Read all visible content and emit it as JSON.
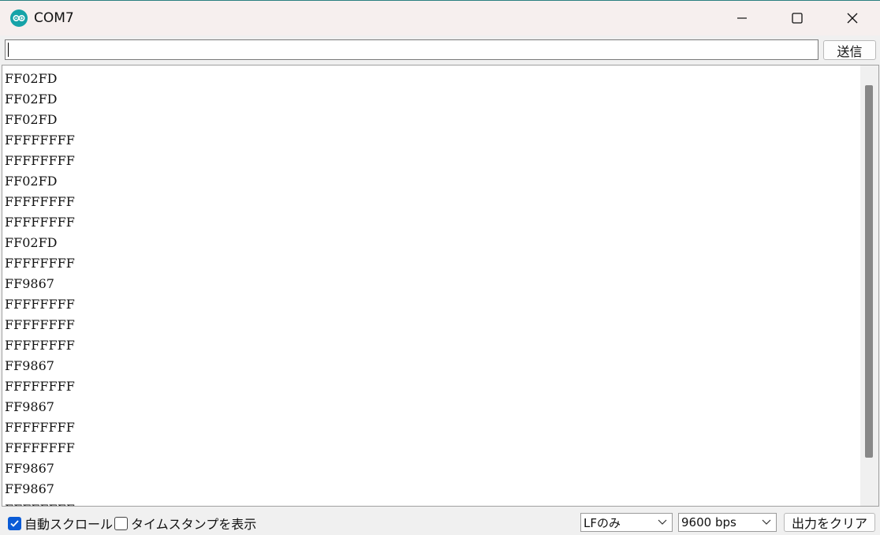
{
  "window": {
    "title": "COM7",
    "minimize_icon": "minimize-icon",
    "maximize_icon": "maximize-icon",
    "close_icon": "close-icon"
  },
  "send_bar": {
    "input_value": "",
    "send_label": "送信"
  },
  "output": {
    "lines": [
      "FF02FD",
      "FF02FD",
      "FF02FD",
      "FFFFFFFF",
      "FFFFFFFF",
      "FF02FD",
      "FFFFFFFF",
      "FFFFFFFF",
      "FF02FD",
      "FFFFFFFF",
      "FF9867",
      "FFFFFFFF",
      "FFFFFFFF",
      "FFFFFFFF",
      "FF9867",
      "FFFFFFFF",
      "FF9867",
      "FFFFFFFF",
      "FFFFFFFF",
      "FF9867",
      "FF9867",
      "FFFFFFFF"
    ]
  },
  "bottom_bar": {
    "autoscroll_label": "自動スクロール",
    "autoscroll_checked": true,
    "timestamp_label": "タイムスタンプを表示",
    "timestamp_checked": false,
    "line_ending_value": "LFのみ",
    "baud_rate_value": "9600 bps",
    "clear_output_label": "出力をクリア"
  },
  "colors": {
    "accent": "#0a5bd6",
    "app_icon": "#16a3a8",
    "titlebar_bg": "#f6efee"
  }
}
